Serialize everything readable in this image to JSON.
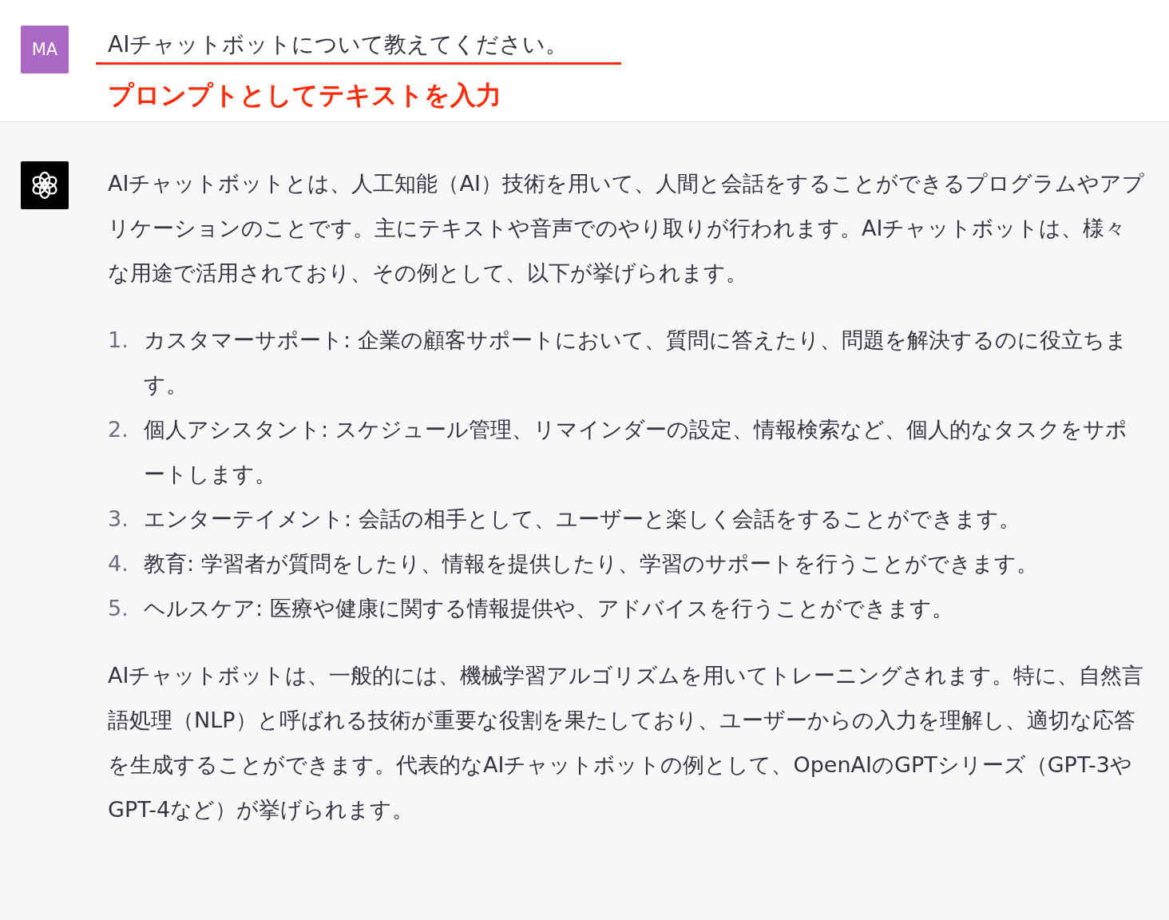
{
  "user_message": {
    "avatar": "MA",
    "text": "AIチャットボットについて教えてください。",
    "annotation": "プロンプトとしてテキストを入力"
  },
  "assistant_message": {
    "intro": "AIチャットボットとは、人工知能（AI）技術を用いて、人間と会話をすることができるプログラムやアプリケーションのことです。主にテキストや音声でのやり取りが行われます。AIチャットボットは、様々な用途で活用されており、その例として、以下が挙げられます。",
    "list": [
      {
        "number": "1.",
        "text": "カスタマーサポート: 企業の顧客サポートにおいて、質問に答えたり、問題を解決するのに役立ちます。"
      },
      {
        "number": "2.",
        "text": "個人アシスタント: スケジュール管理、リマインダーの設定、情報検索など、個人的なタスクをサポートします。"
      },
      {
        "number": "3.",
        "text": "エンターテイメント: 会話の相手として、ユーザーと楽しく会話をすることができます。"
      },
      {
        "number": "4.",
        "text": "教育: 学習者が質問をしたり、情報を提供したり、学習のサポートを行うことができます。"
      },
      {
        "number": "5.",
        "text": "ヘルスケア: 医療や健康に関する情報提供や、アドバイスを行うことができます。"
      }
    ],
    "outro": "AIチャットボットは、一般的には、機械学習アルゴリズムを用いてトレーニングされます。特に、自然言語処理（NLP）と呼ばれる技術が重要な役割を果たしており、ユーザーからの入力を理解し、適切な応答を生成することができます。代表的なAIチャットボットの例として、OpenAIのGPTシリーズ（GPT-3やGPT-4など）が挙げられます。"
  }
}
